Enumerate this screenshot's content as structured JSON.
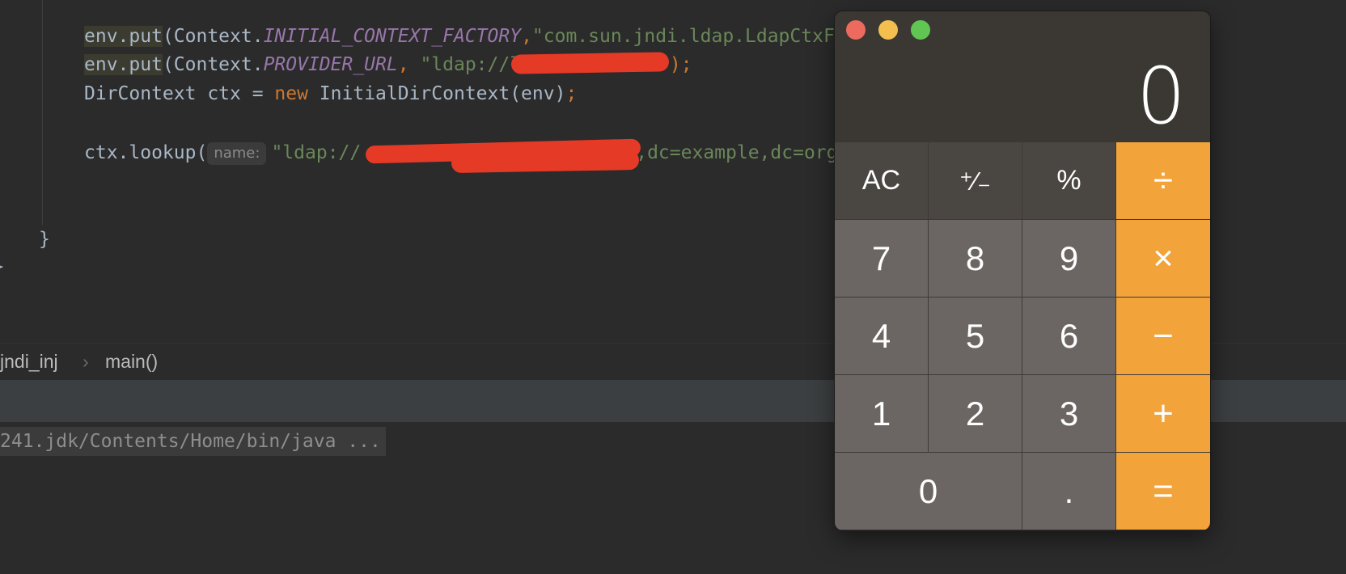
{
  "editor": {
    "lines": [
      {
        "obj": "env.put",
        "p1": "(Context.",
        "const": "INITIAL_CONTEXT_FACTORY",
        "sep": ",",
        "str": "\"com.sun.jndi.ldap.LdapCtxF"
      },
      {
        "obj": "env.put",
        "p1": "(Context.",
        "const": "PROVIDER_URL",
        "sep": ", ",
        "str": "\"ldap://l",
        "str_end": "\"",
        "close": ");"
      },
      {
        "t1": "DirContext ctx = ",
        "kw": "new",
        "t2": " InitialDirContext(env)",
        "semi": ";"
      },
      {
        "t1": "ctx.lookup(",
        "hint": "name:",
        "str": "\"ldap://",
        "str_end": ",dc=example,dc=org"
      }
    ],
    "close_brace": "}"
  },
  "breadcrumb": {
    "items": [
      "jndi_inj",
      "main()"
    ],
    "separator": "›"
  },
  "console": {
    "line": "241.jdk/Contents/Home/bin/java ..."
  },
  "calculator": {
    "display": "0",
    "keys": [
      "AC",
      "+/-",
      "%",
      "÷",
      "7",
      "8",
      "9",
      "×",
      "4",
      "5",
      "6",
      "−",
      "1",
      "2",
      "3",
      "+",
      "0",
      ".",
      "="
    ],
    "colors": {
      "operator": "#f2a33a",
      "number": "#6b6663",
      "function": "#4a4642"
    }
  }
}
